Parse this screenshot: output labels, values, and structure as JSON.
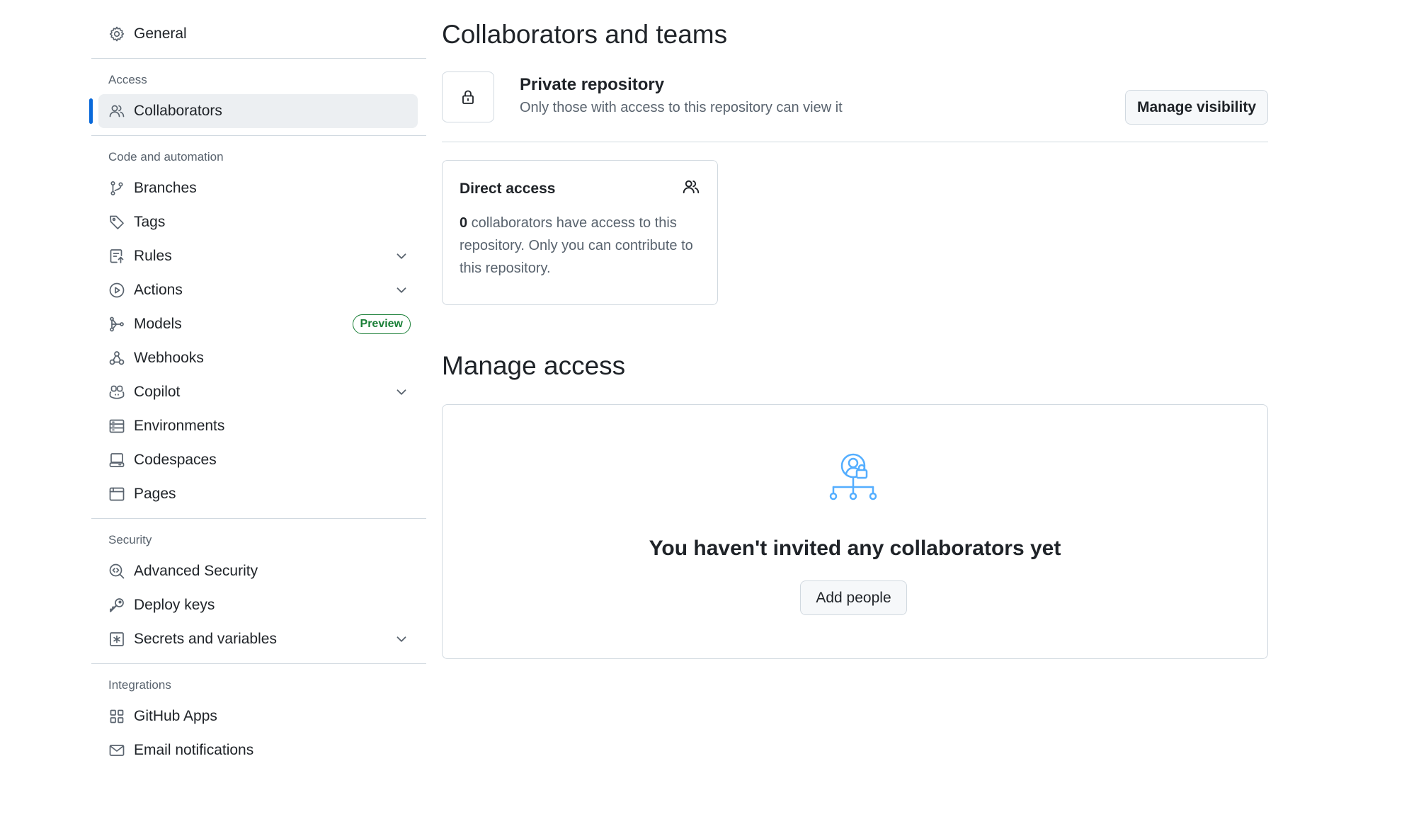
{
  "sidebar": {
    "general": "General",
    "sections": {
      "access": "Access",
      "code_automation": "Code and automation",
      "security": "Security",
      "integrations": "Integrations"
    },
    "items": {
      "collaborators": "Collaborators",
      "branches": "Branches",
      "tags": "Tags",
      "rules": "Rules",
      "actions": "Actions",
      "models": "Models",
      "models_badge": "Preview",
      "webhooks": "Webhooks",
      "copilot": "Copilot",
      "environments": "Environments",
      "codespaces": "Codespaces",
      "pages": "Pages",
      "advanced_security": "Advanced Security",
      "deploy_keys": "Deploy keys",
      "secrets_variables": "Secrets and variables",
      "github_apps": "GitHub Apps",
      "email_notifications": "Email notifications"
    },
    "active_item": "collaborators"
  },
  "main": {
    "title": "Collaborators and teams",
    "visibility": {
      "title": "Private repository",
      "subtitle": "Only those with access to this repository can view it",
      "button": "Manage visibility"
    },
    "direct_access": {
      "title": "Direct access",
      "count": "0",
      "description": " collaborators have access to this repository. Only you can contribute to this repository."
    },
    "manage_access": {
      "title": "Manage access",
      "empty_title": "You haven't invited any collaborators yet",
      "button": "Add people"
    }
  },
  "colors": {
    "accent": "#0969da",
    "preview_badge": "#1a7f37",
    "illustration": "#54aeff"
  }
}
